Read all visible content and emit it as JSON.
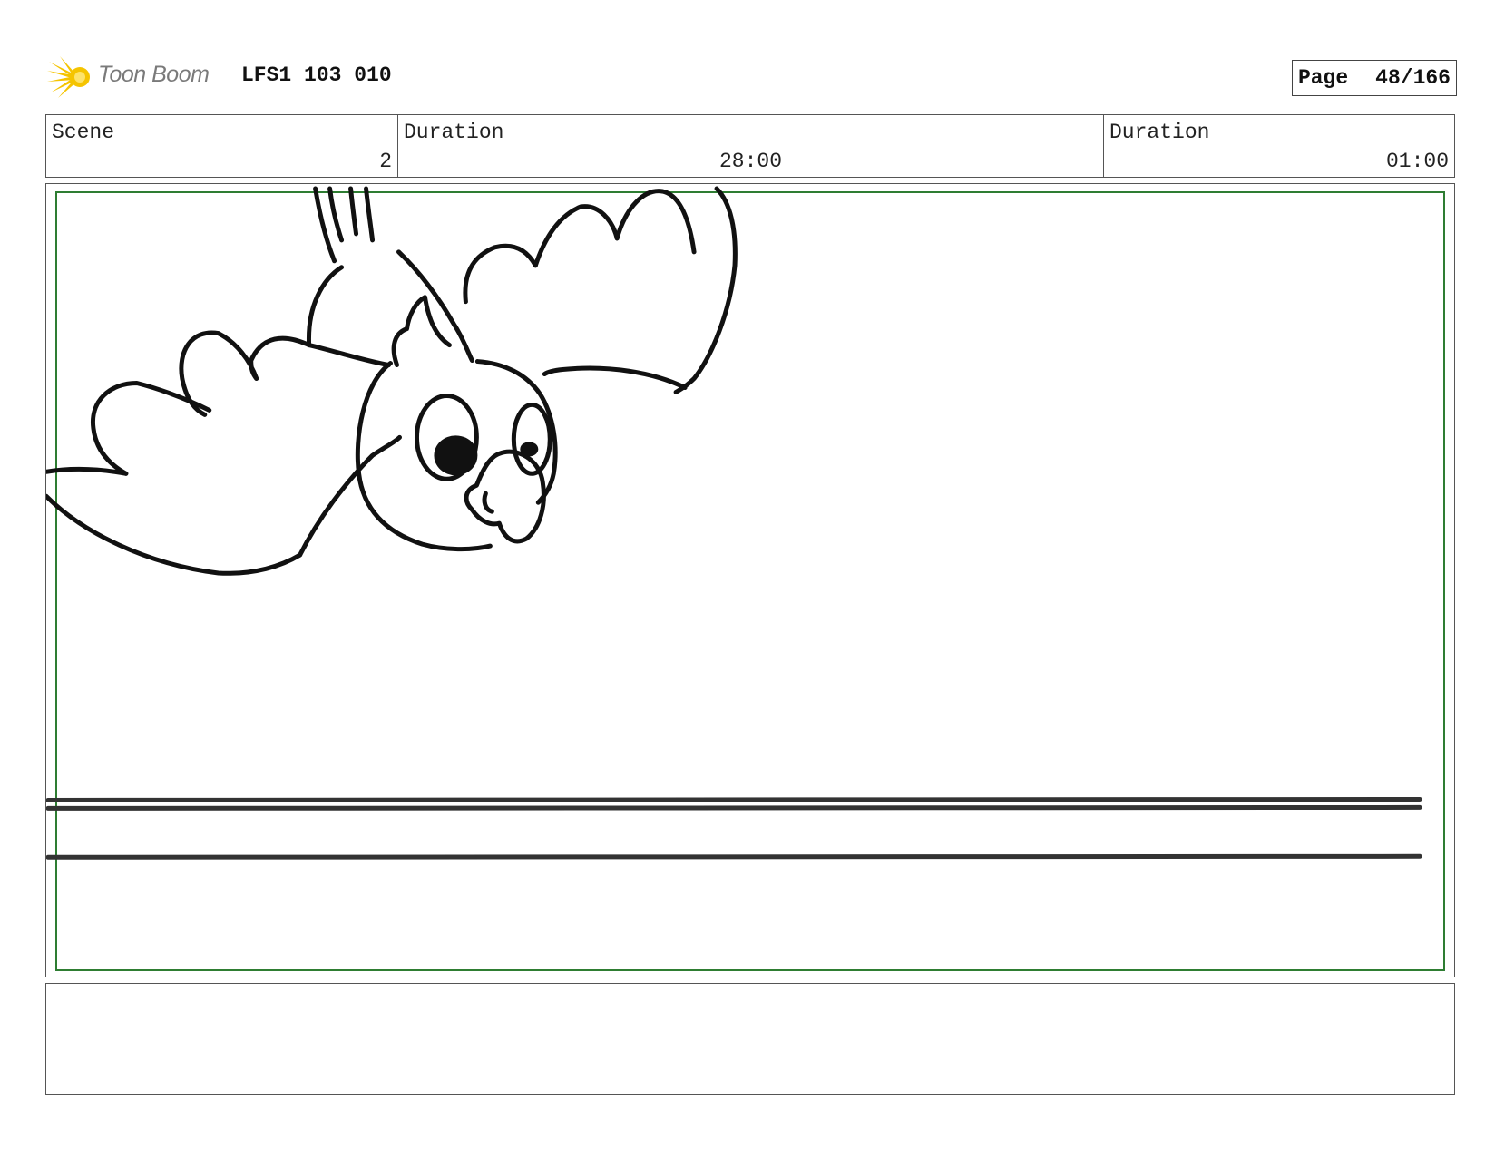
{
  "header": {
    "brand": "Toon Boom",
    "sheet_id": "LFS1 103 010",
    "page_label": "Page",
    "page_number": "48/166"
  },
  "info": {
    "scene_label": "Scene",
    "scene_value": "2",
    "duration_label": "Duration",
    "duration_value": "28:00",
    "panel_duration_label": "Duration",
    "panel_duration_value": "01:00"
  },
  "colors": {
    "safe_frame": "#2e7d32",
    "logo": "#f5c400"
  },
  "icons": {
    "logo": "toon-boom-logo-icon"
  }
}
